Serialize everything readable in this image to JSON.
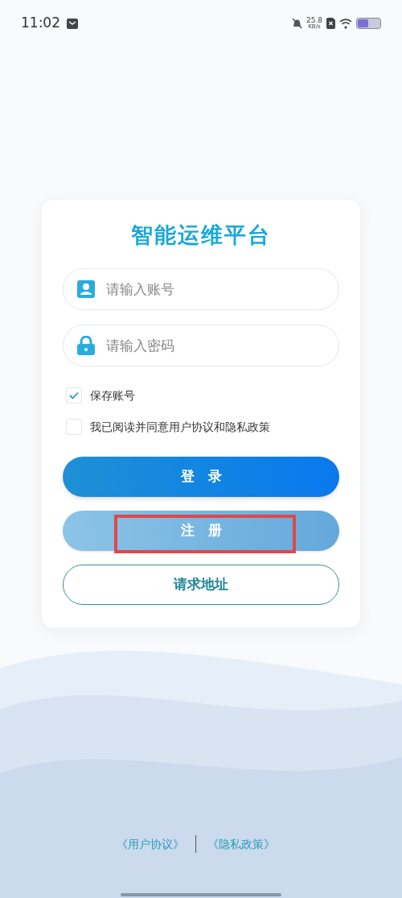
{
  "status_bar": {
    "time": "11:02",
    "net_speed": "25.8",
    "net_unit": "KB/s"
  },
  "title": "智能运维平台",
  "fields": [
    {
      "kind": "account",
      "placeholder": "请输入账号"
    },
    {
      "kind": "password",
      "placeholder": "请输入密码"
    }
  ],
  "checkboxes": [
    {
      "label": "保存账号",
      "checked": true
    },
    {
      "label": "我已阅读并同意用户协议和隐私政策",
      "checked": false
    }
  ],
  "buttons": [
    {
      "kind": "primary",
      "label": "登　录",
      "highlighted": false
    },
    {
      "kind": "secondary",
      "label": "注　册",
      "highlighted": true
    },
    {
      "kind": "outline",
      "label": "请求地址",
      "highlighted": false
    }
  ],
  "footer_links": [
    "《用户协议》",
    "《隐私政策》"
  ]
}
